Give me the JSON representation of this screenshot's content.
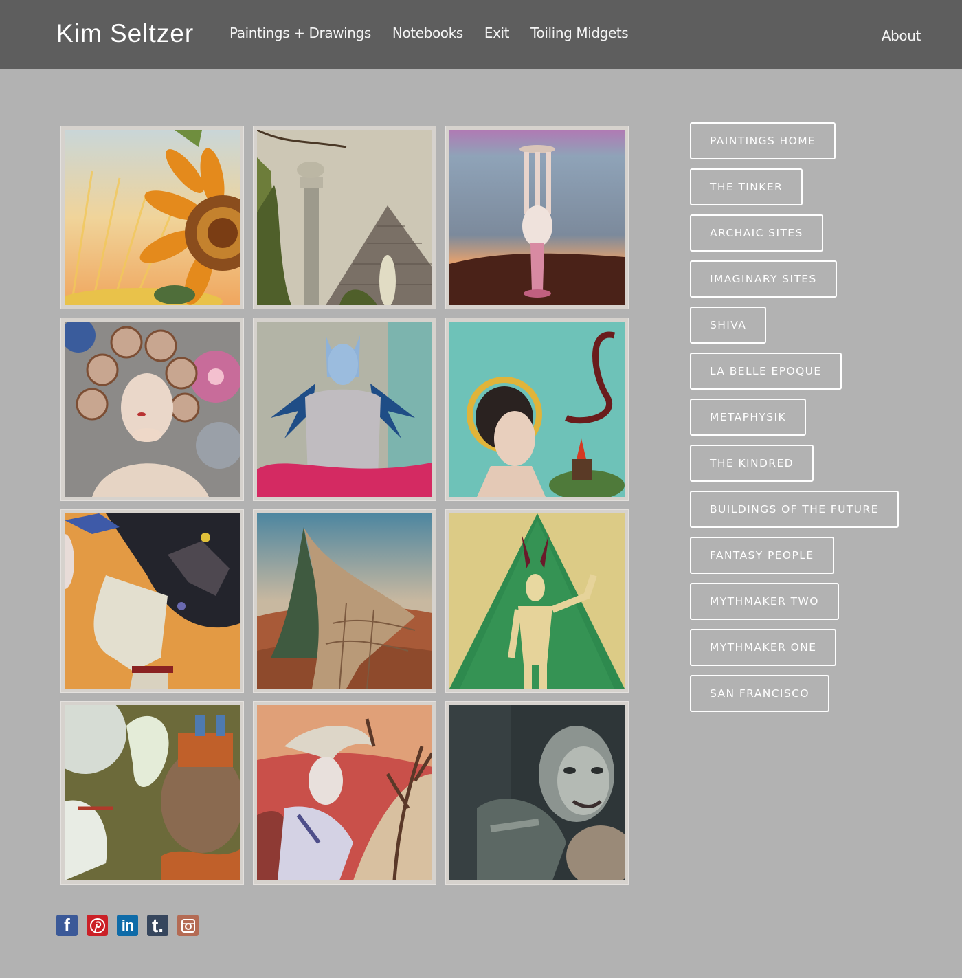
{
  "header": {
    "brand": "Kim Seltzer",
    "nav": [
      {
        "label": "Paintings + Drawings"
      },
      {
        "label": "Notebooks"
      },
      {
        "label": "Exit"
      },
      {
        "label": "Toiling Midgets"
      }
    ],
    "about": "About"
  },
  "gallery": {
    "tiles": [
      {
        "icon": "sunflower-sunrise-painting"
      },
      {
        "icon": "pillar-pyramid-painting"
      },
      {
        "icon": "floating-column-painting"
      },
      {
        "icon": "floral-headdress-figure-painting"
      },
      {
        "icon": "winged-blue-figure-painting"
      },
      {
        "icon": "haloed-woman-serpent-painting"
      },
      {
        "icon": "bat-woman-profile-painting"
      },
      {
        "icon": "curved-tower-landscape-painting"
      },
      {
        "icon": "horned-figure-green-triangle-painting"
      },
      {
        "icon": "crowned-surreal-figures-painting"
      },
      {
        "icon": "windswept-figure-painting"
      },
      {
        "icon": "dark-masked-face-painting"
      }
    ]
  },
  "sidebar": {
    "categories": [
      {
        "label": "PAINTINGS HOME"
      },
      {
        "label": "THE TINKER"
      },
      {
        "label": "ARCHAIC SITES"
      },
      {
        "label": "IMAGINARY SITES"
      },
      {
        "label": "SHIVA"
      },
      {
        "label": "LA BELLE EPOQUE"
      },
      {
        "label": "METAPHYSIK"
      },
      {
        "label": "THE KINDRED"
      },
      {
        "label": "BUILDINGS OF THE FUTURE"
      },
      {
        "label": "FANTASY PEOPLE"
      },
      {
        "label": "MYTHMAKER TWO"
      },
      {
        "label": "MYTHMAKER ONE"
      },
      {
        "label": "SAN FRANCISCO"
      }
    ]
  },
  "social": {
    "facebook": "f",
    "linkedin": "in",
    "tumblr": "t."
  },
  "colors": {
    "page_bg": "#b2b2b2",
    "header_bg": "#5e5e5e",
    "text": "#ffffff"
  }
}
